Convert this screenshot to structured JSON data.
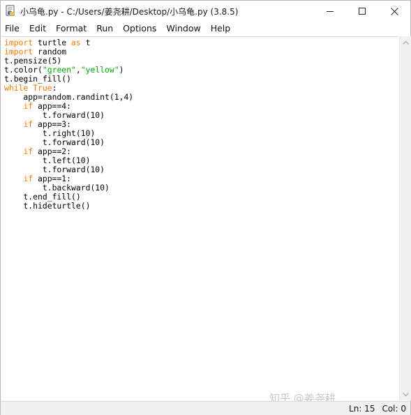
{
  "window": {
    "title": "小乌龟.py - C:/Users/姜尧耕/Desktop/小乌龟.py (3.8.5)"
  },
  "menu": {
    "items": [
      "File",
      "Edit",
      "Format",
      "Run",
      "Options",
      "Window",
      "Help"
    ]
  },
  "editor": {
    "lines": [
      [
        {
          "t": "import",
          "c": "kw"
        },
        {
          "t": " turtle "
        },
        {
          "t": "as",
          "c": "kw"
        },
        {
          "t": " t"
        }
      ],
      [
        {
          "t": "import",
          "c": "kw"
        },
        {
          "t": " random"
        }
      ],
      [
        {
          "t": "t.pensize(5)"
        }
      ],
      [
        {
          "t": "t.color("
        },
        {
          "t": "\"green\"",
          "c": "str"
        },
        {
          "t": ","
        },
        {
          "t": "\"yellow\"",
          "c": "str"
        },
        {
          "t": ")"
        }
      ],
      [
        {
          "t": "t.begin_fill()"
        }
      ],
      [
        {
          "t": "while",
          "c": "kw"
        },
        {
          "t": " "
        },
        {
          "t": "True",
          "c": "kw"
        },
        {
          "t": ":"
        }
      ],
      [
        {
          "t": "    app=random.randint(1,4)"
        }
      ],
      [
        {
          "t": "    "
        },
        {
          "t": "if",
          "c": "kw"
        },
        {
          "t": " app==4:"
        }
      ],
      [
        {
          "t": "        t.forward(10)"
        }
      ],
      [
        {
          "t": "    "
        },
        {
          "t": "if",
          "c": "kw"
        },
        {
          "t": " app==3:"
        }
      ],
      [
        {
          "t": "        t.right(10)"
        }
      ],
      [
        {
          "t": "        t.forward(10)"
        }
      ],
      [
        {
          "t": "    "
        },
        {
          "t": "if",
          "c": "kw"
        },
        {
          "t": " app==2:"
        }
      ],
      [
        {
          "t": "        t.left(10)"
        }
      ],
      [
        {
          "t": "        t.forward(10)"
        }
      ],
      [
        {
          "t": "    "
        },
        {
          "t": "if",
          "c": "kw"
        },
        {
          "t": " app==1:"
        }
      ],
      [
        {
          "t": "        t.backward(10)"
        }
      ],
      [
        {
          "t": "    t.end_fill()"
        }
      ],
      [
        {
          "t": "    t.hideturtle()"
        }
      ]
    ]
  },
  "watermark": "知乎 @姜尧耕",
  "status": {
    "line": "Ln: 15",
    "col": "Col: 0"
  },
  "colors": {
    "keyword": "#ff7700",
    "string": "#00aa00"
  }
}
